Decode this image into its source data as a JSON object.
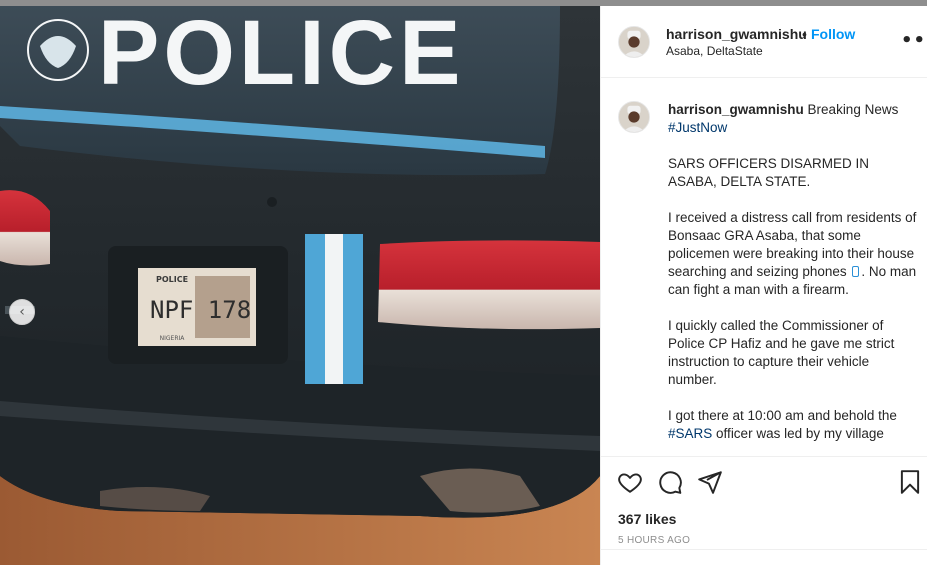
{
  "header": {
    "username": "harrison_gwamnishu",
    "separator": "•",
    "follow_label": "Follow",
    "location": "Asaba, DeltaState",
    "more_label": "•••"
  },
  "photo": {
    "police_text": "POLICE",
    "plate_text": "NPF 178",
    "plate_top": "POLICE",
    "plate_bottom": "NIGERIA",
    "prev_arrow": "‹"
  },
  "caption": {
    "username": "harrison_gwamnishu",
    "intro": "Breaking News",
    "hashtag_justnow": "#JustNow",
    "para1": "SARS OFFICERS DISARMED IN ASABA, DELTA STATE.",
    "para2_before_icon": "I received a distress call from residents of Bonsaac GRA Asaba, that some policemen were breaking into their house searching and seizing phones",
    "para2_after_icon": ". No man can fight a man with a firearm.",
    "para3": "I quickly called the Commissioner of Police CP Hafiz and he gave me strict instruction to capture their vehicle number.",
    "para4_before": "I got there at 10:00 am and behold the",
    "hashtag_sars": "#SARS",
    "para4_after": "officer was led by my village"
  },
  "actions": {
    "likes": "367 likes",
    "time": "5 HOURS AGO"
  },
  "icons": {
    "like": "heart-icon",
    "comment": "comment-icon",
    "share": "share-icon",
    "save": "bookmark-icon",
    "more": "more-icon",
    "prev": "chevron-left-icon",
    "phone": "mobile-phone-icon"
  },
  "colors": {
    "follow": "#0095f6",
    "hashtag": "#00376b",
    "car_body": "#2c3338",
    "police_stripe": "#4fa6d6"
  }
}
